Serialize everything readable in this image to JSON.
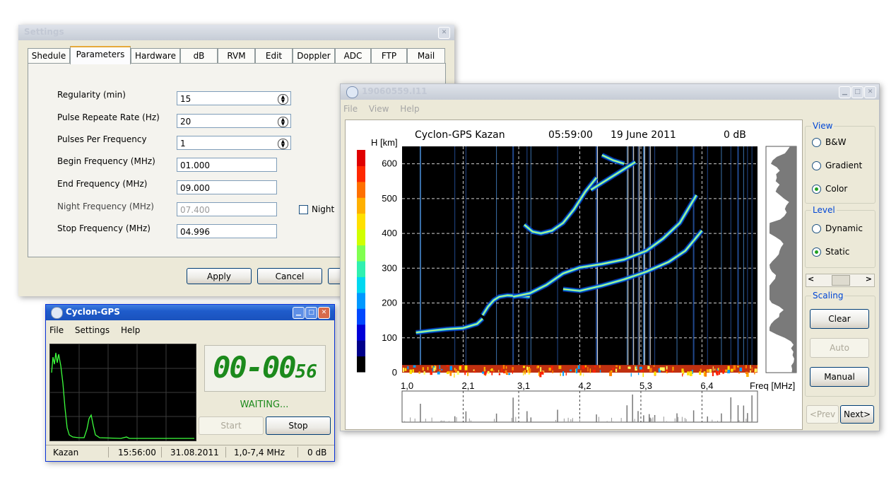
{
  "settings_window": {
    "title": "Settings",
    "tabs": [
      {
        "label": "Shedule",
        "selected": false
      },
      {
        "label": "Parameters",
        "selected": true
      },
      {
        "label": "Hardware",
        "selected": false
      },
      {
        "label": "dB",
        "selected": false
      },
      {
        "label": "RVM",
        "selected": false
      },
      {
        "label": "Edit",
        "selected": false
      },
      {
        "label": "Doppler",
        "selected": false
      },
      {
        "label": "ADC",
        "selected": false
      },
      {
        "label": "FTP",
        "selected": false
      },
      {
        "label": "Mail",
        "selected": false
      }
    ],
    "fields": [
      {
        "label": "Regularity (min)",
        "value": "15",
        "spinner": true
      },
      {
        "label": "Pulse Repeate Rate (Hz)",
        "value": "20",
        "spinner": true
      },
      {
        "label": "Pulses Per Frequency",
        "value": "1",
        "spinner": true
      },
      {
        "label": "Begin Frequency (MHz)",
        "value": "01.000"
      },
      {
        "label": "End Frequency (MHz)",
        "value": "09.000"
      },
      {
        "label": "Night Frequency (MHz)",
        "value": "07.400",
        "disabled": true
      },
      {
        "label": "Stop Frequency (MHz)",
        "value": "04.996"
      }
    ],
    "night_checkbox": {
      "label": "Night",
      "checked": false
    },
    "buttons": {
      "apply": "Apply",
      "cancel": "Cancel"
    }
  },
  "cyclon_window": {
    "title": "Cyclon-GPS",
    "menu": [
      "File",
      "Settings",
      "Help"
    ],
    "timer": {
      "main": "00-00",
      "small": "56"
    },
    "status": "WAITING...",
    "buttons": {
      "start": "Start",
      "stop": "Stop"
    },
    "statusbar": {
      "station": "Kazan",
      "time": "15:56:00",
      "date": "31.08.2011",
      "range": "1,0-7,4 MHz",
      "db": "0 dB"
    }
  },
  "ionogram_window": {
    "title": "19060559.I11",
    "menu": [
      "File",
      "View",
      "Help"
    ],
    "header": {
      "station": "Cyclon-GPS  Kazan",
      "time": "05:59:00",
      "date": "19 June 2011",
      "db": "0 dB"
    },
    "view_group": {
      "title": "View",
      "options": [
        {
          "label": "B&W",
          "selected": false
        },
        {
          "label": "Gradient",
          "selected": false
        },
        {
          "label": "Color",
          "selected": true
        }
      ]
    },
    "level_group": {
      "title": "Level",
      "options": [
        {
          "label": "Dynamic",
          "selected": false
        },
        {
          "label": "Static",
          "selected": true
        }
      ]
    },
    "scaling_group": {
      "title": "Scaling",
      "buttons": {
        "clear": "Clear",
        "auto": "Auto",
        "manual": "Manual"
      }
    },
    "nav": {
      "prev": "<Prev",
      "next": "Next>"
    }
  },
  "chart_data": {
    "type": "heatmap",
    "title": "",
    "xlabel": "Freq [MHz]",
    "ylabel": "H [km]",
    "x_ticks": [
      "1,0",
      "2,1",
      "3,1",
      "4,2",
      "5,3",
      "6,4"
    ],
    "y_ticks": [
      0,
      100,
      200,
      300,
      400,
      500,
      600
    ],
    "xlim": [
      1.0,
      7.4
    ],
    "ylim": [
      0,
      650
    ],
    "grid": true,
    "traces": [
      {
        "x": [
          1.25,
          1.5,
          1.8,
          2.1,
          2.35,
          2.45
        ],
        "y": [
          115,
          120,
          125,
          128,
          140,
          155
        ]
      },
      {
        "x": [
          2.45,
          2.55,
          2.65,
          2.75,
          2.9,
          3.1,
          3.3
        ],
        "y": [
          165,
          190,
          208,
          218,
          222,
          220,
          218
        ]
      },
      {
        "x": [
          3.0,
          3.3,
          3.6,
          3.9,
          4.2,
          4.6,
          5.0,
          5.4,
          5.7,
          6.0,
          6.3
        ],
        "y": [
          218,
          228,
          252,
          285,
          302,
          312,
          325,
          350,
          385,
          430,
          510
        ]
      },
      {
        "x": [
          3.9,
          4.2,
          4.6,
          5.0,
          5.4,
          5.8,
          6.1,
          6.4
        ],
        "y": [
          240,
          235,
          250,
          268,
          290,
          318,
          350,
          408
        ]
      },
      {
        "x": [
          3.2,
          3.35,
          3.5,
          3.7,
          3.9,
          4.1,
          4.3,
          4.5
        ],
        "y": [
          425,
          405,
          400,
          408,
          430,
          470,
          520,
          560
        ]
      },
      {
        "x": [
          4.4,
          4.6,
          4.8,
          5.0,
          5.2
        ],
        "y": [
          525,
          545,
          565,
          585,
          605
        ]
      },
      {
        "x": [
          4.6,
          4.8,
          5.0
        ],
        "y": [
          625,
          610,
          600
        ]
      }
    ],
    "vertical_lines_mhz": [
      1.33,
      1.95,
      2.15,
      2.7,
      3.0,
      3.25,
      3.32,
      3.8,
      4.5,
      5.05,
      5.15,
      5.25,
      5.35,
      5.45,
      5.55,
      5.95,
      6.25,
      6.5,
      6.75,
      6.92,
      7.05,
      7.15,
      7.22,
      7.3
    ],
    "colorbar": [
      "#000000",
      "#00008a",
      "#0000d8",
      "#0048ff",
      "#0098ff",
      "#00d8f0",
      "#30f0b0",
      "#80ff50",
      "#d0ff00",
      "#ffe000",
      "#ffb000",
      "#ff7000",
      "#ff2800",
      "#e00000"
    ]
  }
}
